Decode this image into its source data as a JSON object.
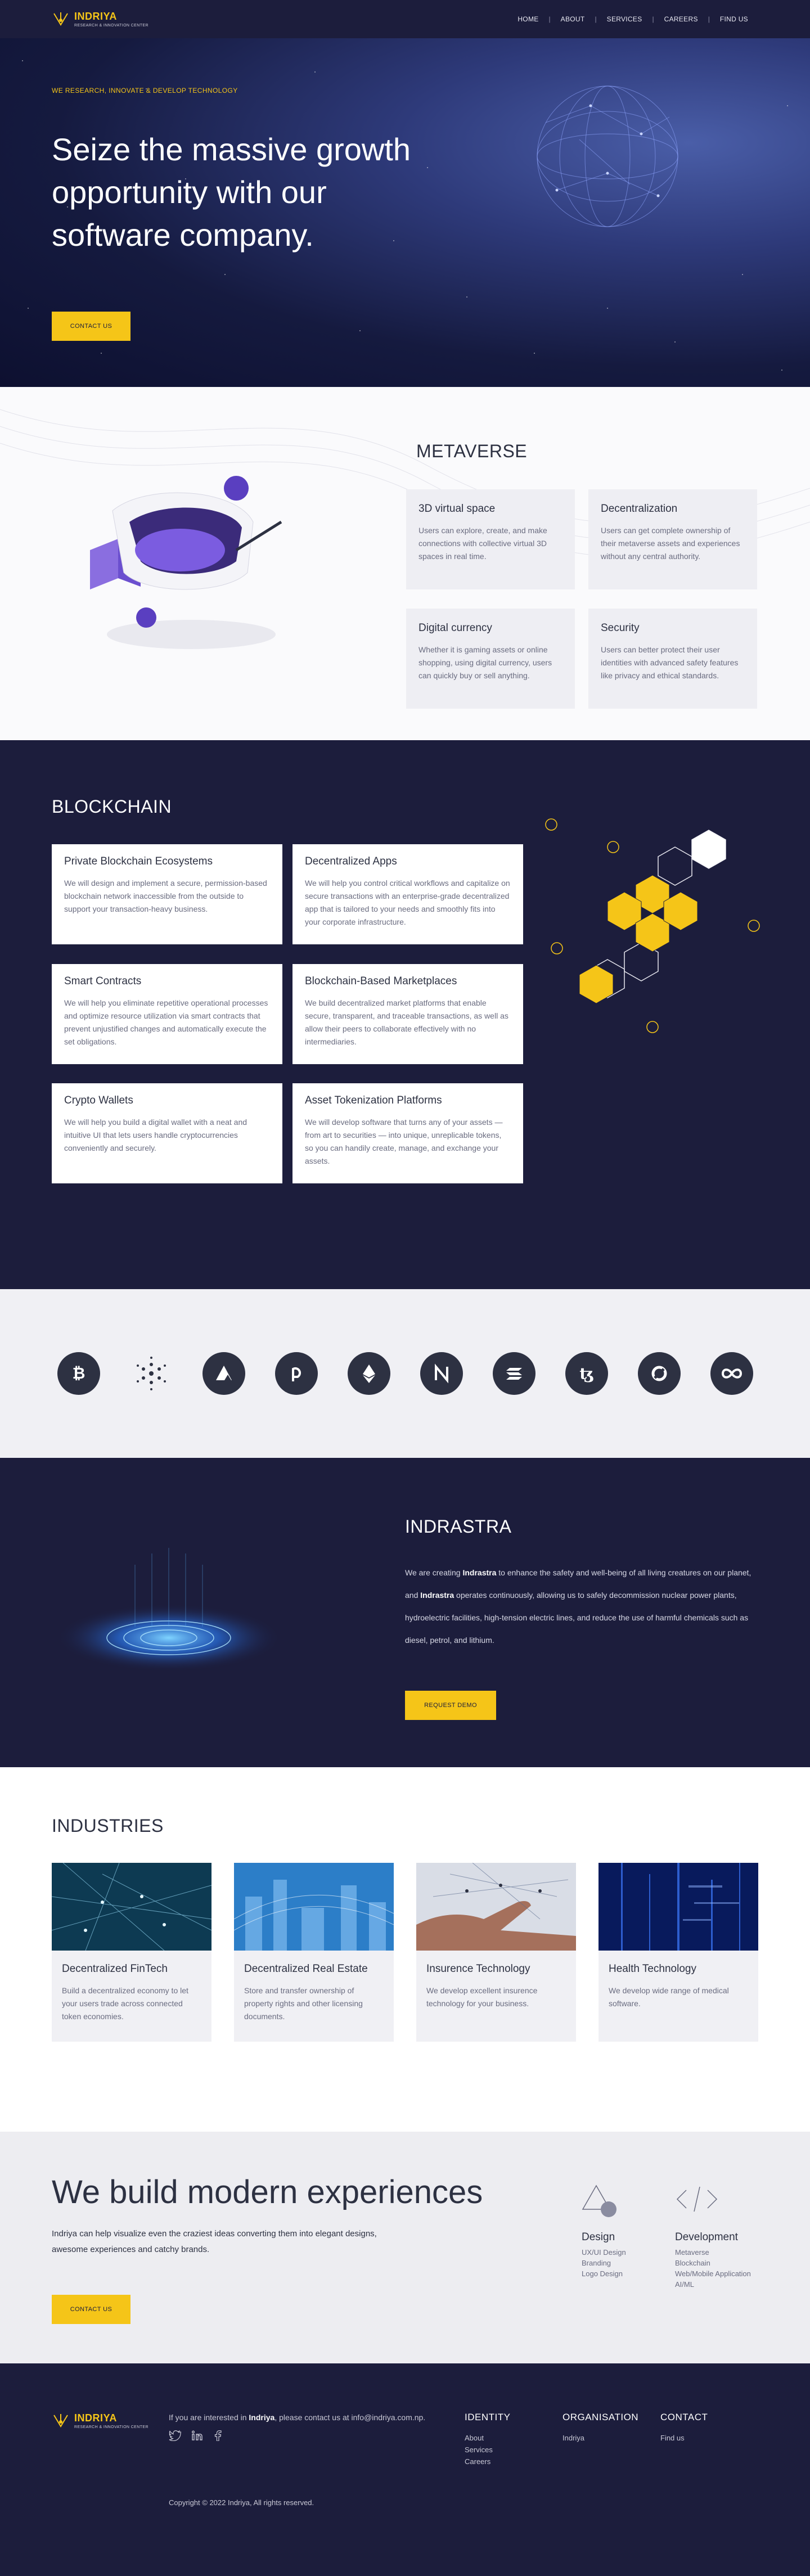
{
  "nav": {
    "brand_name": "INDRIYA",
    "brand_tagline": "RESEARCH & INNOVATION CENTER",
    "items": [
      "HOME",
      "ABOUT",
      "SERVICES",
      "CAREERS",
      "FIND US"
    ],
    "separator": "|"
  },
  "hero": {
    "kicker": "WE RESEARCH, INNOVATE & DEVELOP TECHNOLOGY",
    "title": "Seize the massive growth opportunity with our software company.",
    "button": "CONTACT US"
  },
  "metaverse": {
    "title": "METAVERSE",
    "cards": [
      {
        "title": "3D virtual space",
        "text": "Users can explore, create, and make connections with collective virtual 3D spaces in real time."
      },
      {
        "title": "Decentralization",
        "text": "Users can get complete ownership of their metaverse assets and experiences without any central authority."
      },
      {
        "title": "Digital currency",
        "text": "Whether it is gaming assets or online shopping, using digital currency, users can quickly buy or sell anything."
      },
      {
        "title": "Security",
        "text": "Users can better protect their user identities with advanced safety features like privacy and ethical standards."
      }
    ]
  },
  "blockchain": {
    "title": "BLOCKCHAIN",
    "cards": [
      {
        "title": "Private Blockchain Ecosystems",
        "text": "We will design and implement a secure, permission-based blockchain network inaccessible from the outside to support your transaction-heavy business."
      },
      {
        "title": "Decentralized Apps",
        "text": "We will help you control critical workflows and capitalize on secure transactions with an enterprise-grade decentralized app that is tailored to your needs and smoothly fits into your corporate infrastructure."
      },
      {
        "title": "Smart Contracts",
        "text": "We will help you eliminate repetitive operational processes and optimize resource utilization via smart contracts that prevent unjustified changes and automatically execute the set obligations."
      },
      {
        "title": "Blockchain-Based Marketplaces",
        "text": "We build decentralized market platforms that enable secure, transparent, and traceable transactions, as well as allow their peers to collaborate effectively with no intermediaries."
      },
      {
        "title": "Crypto Wallets",
        "text": "We will help you build a digital wallet with a neat and intuitive UI that lets users handle cryptocurrencies conveniently and securely."
      },
      {
        "title": "Asset Tokenization Platforms",
        "text": "We will develop software that turns any of your assets — from art to securities — into unique, unreplicable tokens, so you can handily create, manage, and exchange your assets."
      }
    ]
  },
  "coins": [
    "bitcoin-icon",
    "cardano-icon",
    "avalanche-icon",
    "polkadot-icon",
    "ethereum-icon",
    "near-icon",
    "solana-icon",
    "tezos-icon",
    "harmony-icon",
    "infinity-icon"
  ],
  "indrastra": {
    "title": "INDRASTRA",
    "text_1": "We are creating ",
    "bold_1": "Indrastra",
    "text_2": " to enhance the safety and well-being of all living creatures on our planet, and ",
    "bold_2": "Indrastra",
    "text_3": " operates continuously, allowing us to safely decommission nuclear power plants, hydroelectric facilities, high-tension electric lines, and reduce the use of harmful chemicals such as diesel, petrol, and lithium.",
    "button": "REQUEST DEMO"
  },
  "industries": {
    "title": "INDUSTRIES",
    "cards": [
      {
        "title": "Decentralized FinTech",
        "text": "Build a decentralized economy to let your users trade across connected token economies."
      },
      {
        "title": "Decentralized Real Estate",
        "text": "Store and transfer ownership of property rights and other licensing documents."
      },
      {
        "title": "Insurence Technology",
        "text": "We develop excellent insurence technology for your business."
      },
      {
        "title": "Health Technology",
        "text": "We develop wide range of medical software."
      }
    ]
  },
  "build": {
    "title": "We build modern experiences",
    "text": "Indriya can help visualize even the craziest ideas converting them into elegant designs, awesome experiences and catchy brands.",
    "button": "CONTACT US",
    "services": [
      {
        "title": "Design",
        "items": [
          "UX/UI Design",
          "Branding",
          "Logo Design"
        ]
      },
      {
        "title": "Development",
        "items": [
          "Metaverse",
          "Blockchain",
          "Web/Mobile Application",
          "AI/ML"
        ]
      }
    ]
  },
  "footer": {
    "contact_prefix": "If you are interested in ",
    "contact_bold": "Indriya",
    "contact_suffix": ", please contact us at info@indriya.com.np.",
    "columns": [
      {
        "title": "IDENTITY",
        "links": [
          "About",
          "Services",
          "Careers"
        ]
      },
      {
        "title": "ORGANISATION",
        "links": [
          "Indriya"
        ]
      },
      {
        "title": "CONTACT",
        "links": [
          "Find us"
        ]
      }
    ],
    "copyright": "Copyright © 2022 Indriya, All rights reserved."
  },
  "colors": {
    "navy": "#1c1d3c",
    "accent": "#f5c518",
    "hero_blue": "#3d4f99"
  }
}
